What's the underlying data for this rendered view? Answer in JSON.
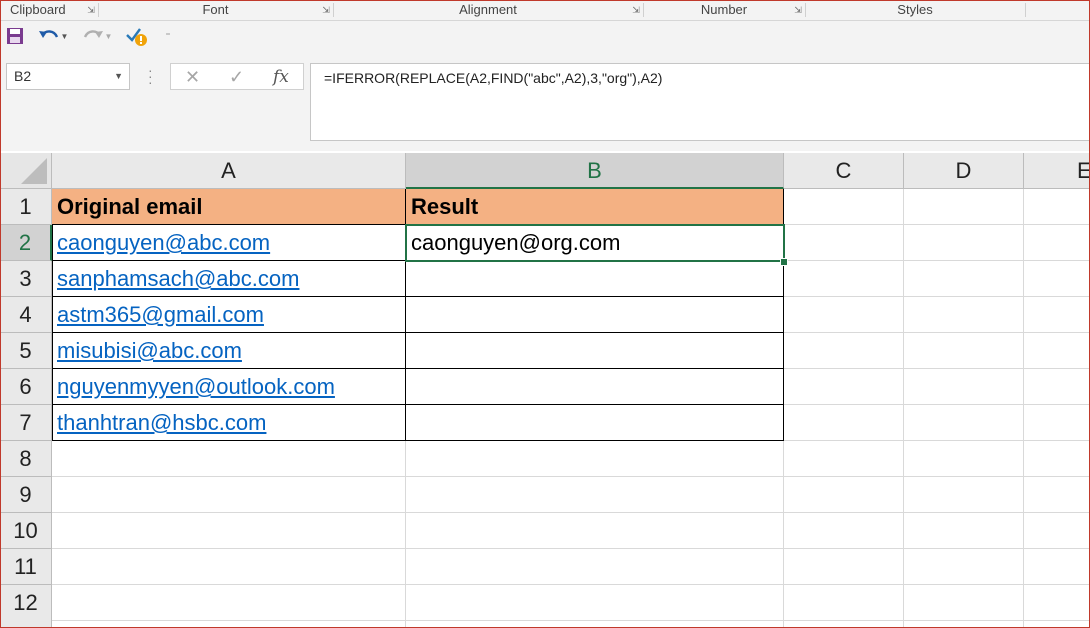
{
  "ribbon": {
    "groups": [
      "Clipboard",
      "Font",
      "Alignment",
      "Number",
      "Styles"
    ]
  },
  "qat": {
    "save_icon": "save-icon",
    "undo_icon": "undo-icon",
    "redo_icon": "redo-icon",
    "spellcheck_icon": "spellcheck-icon",
    "customize_icon": "customize-qat-icon"
  },
  "formula_bar": {
    "name_box": "B2",
    "fx_label": "fx",
    "formula": "=IFERROR(REPLACE(A2,FIND(\"abc\",A2),3,\"org\"),A2)"
  },
  "sheet": {
    "columns": [
      "A",
      "B",
      "C",
      "D",
      "E"
    ],
    "rows": [
      "1",
      "2",
      "3",
      "4",
      "5",
      "6",
      "7",
      "8",
      "9",
      "10",
      "11",
      "12"
    ],
    "header_a": "Original email",
    "header_b": "Result",
    "emails": [
      "caonguyen@abc.com",
      "sanphamsach@abc.com",
      "astm365@gmail.com",
      "misubisi@abc.com",
      "nguyenmyyen@outlook.com",
      "thanhtran@hsbc.com"
    ],
    "results": [
      "caonguyen@org.com",
      "",
      "",
      "",
      "",
      ""
    ],
    "active_cell": "B2",
    "colors": {
      "header_fill": "#f4b183",
      "link": "#0563c1",
      "selection": "#217346"
    }
  }
}
